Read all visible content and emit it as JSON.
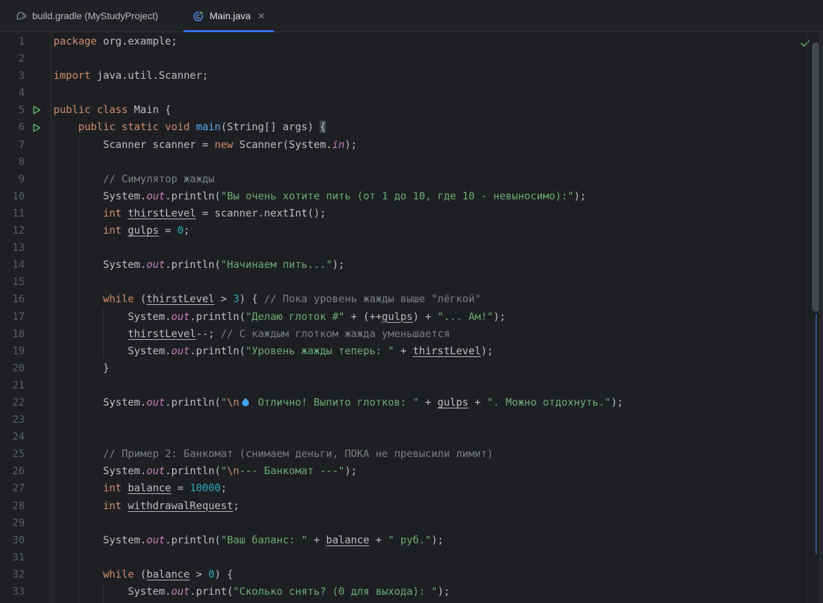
{
  "tabbar": {
    "tabs": [
      {
        "label": "build.gradle (MyStudyProject)",
        "icon": "gradle-icon",
        "active": false
      },
      {
        "label": "Main.java",
        "icon": "java-runnable-class-icon",
        "active": true,
        "close": "✕"
      }
    ]
  },
  "colors": {
    "editor_bg": "#1E1F22",
    "tabbar_bg": "#1F2124",
    "active_tab_underline": "#3574F0",
    "keyword": "#CF8E6D",
    "string": "#6AAB73",
    "number": "#2AACB8",
    "comment": "#7A7E85",
    "static_field": "#C77DBB",
    "method_declaration": "#56A8F5",
    "default_text": "#BCBEC4",
    "run_icon_green": "#5FAD65",
    "inspection_ok_green": "#5C9A5F"
  },
  "editor": {
    "inspection_status": "no-problems-checkmark",
    "lines": [
      {
        "num": 1,
        "tokens": [
          [
            "kw",
            "package"
          ],
          [
            "def",
            " org.example;"
          ]
        ]
      },
      {
        "num": 2,
        "tokens": []
      },
      {
        "num": 3,
        "tokens": [
          [
            "kw",
            "import"
          ],
          [
            "def",
            " java.util.Scanner;"
          ]
        ]
      },
      {
        "num": 4,
        "tokens": []
      },
      {
        "num": 5,
        "gutter_icon": "run",
        "tokens": [
          [
            "kw",
            "public class"
          ],
          [
            "def",
            " Main {"
          ]
        ]
      },
      {
        "num": 6,
        "gutter_icon": "run",
        "tokens": [
          [
            "def",
            "    "
          ],
          [
            "kw",
            "public static void"
          ],
          [
            "def",
            " "
          ],
          [
            "mdecl",
            "main"
          ],
          [
            "def",
            "(String[] args) "
          ],
          [
            "bhl",
            "{"
          ]
        ]
      },
      {
        "num": 7,
        "tokens": [
          [
            "def",
            "        Scanner scanner = "
          ],
          [
            "kw",
            "new"
          ],
          [
            "def",
            " Scanner(System."
          ],
          [
            "field",
            "in"
          ],
          [
            "def",
            ");"
          ]
        ]
      },
      {
        "num": 8,
        "tokens": []
      },
      {
        "num": 9,
        "tokens": [
          [
            "def",
            "        "
          ],
          [
            "cmt",
            "// Симулятор жажды"
          ]
        ]
      },
      {
        "num": 10,
        "tokens": [
          [
            "def",
            "        System."
          ],
          [
            "field",
            "out"
          ],
          [
            "def",
            ".println("
          ],
          [
            "str",
            "\"Вы очень хотите пить (от 1 до 10, где 10 - невыносимо):\""
          ],
          [
            "def",
            ");"
          ]
        ]
      },
      {
        "num": 11,
        "tokens": [
          [
            "def",
            "        "
          ],
          [
            "kw",
            "int"
          ],
          [
            "def",
            " "
          ],
          [
            "var",
            "thirstLevel"
          ],
          [
            "def",
            " = scanner.nextInt();"
          ]
        ]
      },
      {
        "num": 12,
        "tokens": [
          [
            "def",
            "        "
          ],
          [
            "kw",
            "int"
          ],
          [
            "def",
            " "
          ],
          [
            "var",
            "gulps"
          ],
          [
            "def",
            " = "
          ],
          [
            "num",
            "0"
          ],
          [
            "def",
            ";"
          ]
        ]
      },
      {
        "num": 13,
        "tokens": []
      },
      {
        "num": 14,
        "tokens": [
          [
            "def",
            "        System."
          ],
          [
            "field",
            "out"
          ],
          [
            "def",
            ".println("
          ],
          [
            "str",
            "\"Начинаем пить...\""
          ],
          [
            "def",
            ");"
          ]
        ]
      },
      {
        "num": 15,
        "tokens": []
      },
      {
        "num": 16,
        "tokens": [
          [
            "def",
            "        "
          ],
          [
            "kw",
            "while"
          ],
          [
            "def",
            " ("
          ],
          [
            "var",
            "thirstLevel"
          ],
          [
            "def",
            " > "
          ],
          [
            "num",
            "3"
          ],
          [
            "def",
            ") { "
          ],
          [
            "cmt",
            "// Пока уровень жажды выше \"лёгкой\""
          ]
        ]
      },
      {
        "num": 17,
        "tokens": [
          [
            "def",
            "            System."
          ],
          [
            "field",
            "out"
          ],
          [
            "def",
            ".println("
          ],
          [
            "str",
            "\"Делаю глоток #\""
          ],
          [
            "def",
            " + (++"
          ],
          [
            "var",
            "gulps"
          ],
          [
            "def",
            ") + "
          ],
          [
            "str",
            "\"... Ам!\""
          ],
          [
            "def",
            ");"
          ]
        ]
      },
      {
        "num": 18,
        "tokens": [
          [
            "def",
            "            "
          ],
          [
            "var",
            "thirstLevel"
          ],
          [
            "def",
            "--; "
          ],
          [
            "cmt",
            "// С каждым глотком жажда уменьшается"
          ]
        ]
      },
      {
        "num": 19,
        "tokens": [
          [
            "def",
            "            System."
          ],
          [
            "field",
            "out"
          ],
          [
            "def",
            ".println("
          ],
          [
            "str",
            "\"Уровень жажды теперь: \""
          ],
          [
            "def",
            " + "
          ],
          [
            "var",
            "thirstLevel"
          ],
          [
            "def",
            ");"
          ]
        ]
      },
      {
        "num": 20,
        "tokens": [
          [
            "def",
            "        }"
          ]
        ]
      },
      {
        "num": 21,
        "tokens": []
      },
      {
        "num": 22,
        "tokens": [
          [
            "def",
            "        System."
          ],
          [
            "field",
            "out"
          ],
          [
            "def",
            ".println("
          ],
          [
            "str",
            "\""
          ],
          [
            "esc",
            "\\n"
          ],
          [
            "drop",
            ""
          ],
          [
            "str",
            " Отлично! Выпито глотков: \""
          ],
          [
            "def",
            " + "
          ],
          [
            "var",
            "gulps"
          ],
          [
            "def",
            " + "
          ],
          [
            "str",
            "\". Можно отдохнуть.\""
          ],
          [
            "def",
            ");"
          ]
        ]
      },
      {
        "num": 23,
        "tokens": []
      },
      {
        "num": 24,
        "tokens": []
      },
      {
        "num": 25,
        "tokens": [
          [
            "def",
            "        "
          ],
          [
            "cmt",
            "// Пример 2: Банкомат (снимаем деньги, ПОКА не превысили лимит)"
          ]
        ]
      },
      {
        "num": 26,
        "tokens": [
          [
            "def",
            "        System."
          ],
          [
            "field",
            "out"
          ],
          [
            "def",
            ".println("
          ],
          [
            "str",
            "\""
          ],
          [
            "esc",
            "\\n"
          ],
          [
            "str",
            "--- Банкомат ---\""
          ],
          [
            "def",
            ");"
          ]
        ]
      },
      {
        "num": 27,
        "tokens": [
          [
            "def",
            "        "
          ],
          [
            "kw",
            "int"
          ],
          [
            "def",
            " "
          ],
          [
            "var",
            "balance"
          ],
          [
            "def",
            " = "
          ],
          [
            "num",
            "10000"
          ],
          [
            "def",
            ";"
          ]
        ]
      },
      {
        "num": 28,
        "tokens": [
          [
            "def",
            "        "
          ],
          [
            "kw",
            "int"
          ],
          [
            "def",
            " "
          ],
          [
            "var",
            "withdrawalRequest"
          ],
          [
            "def",
            ";"
          ]
        ]
      },
      {
        "num": 29,
        "tokens": []
      },
      {
        "num": 30,
        "tokens": [
          [
            "def",
            "        System."
          ],
          [
            "field",
            "out"
          ],
          [
            "def",
            ".println("
          ],
          [
            "str",
            "\"Ваш баланс: \""
          ],
          [
            "def",
            " + "
          ],
          [
            "var",
            "balance"
          ],
          [
            "def",
            " + "
          ],
          [
            "str",
            "\" руб.\""
          ],
          [
            "def",
            ");"
          ]
        ]
      },
      {
        "num": 31,
        "tokens": []
      },
      {
        "num": 32,
        "tokens": [
          [
            "def",
            "        "
          ],
          [
            "kw",
            "while"
          ],
          [
            "def",
            " ("
          ],
          [
            "var",
            "balance"
          ],
          [
            "def",
            " > "
          ],
          [
            "num",
            "0"
          ],
          [
            "def",
            ") {"
          ]
        ]
      },
      {
        "num": 33,
        "tokens": [
          [
            "def",
            "            System."
          ],
          [
            "field",
            "out"
          ],
          [
            "def",
            ".print("
          ],
          [
            "str",
            "\"Сколько снять? (0 для выхода): \""
          ],
          [
            "def",
            ");"
          ]
        ]
      }
    ]
  }
}
